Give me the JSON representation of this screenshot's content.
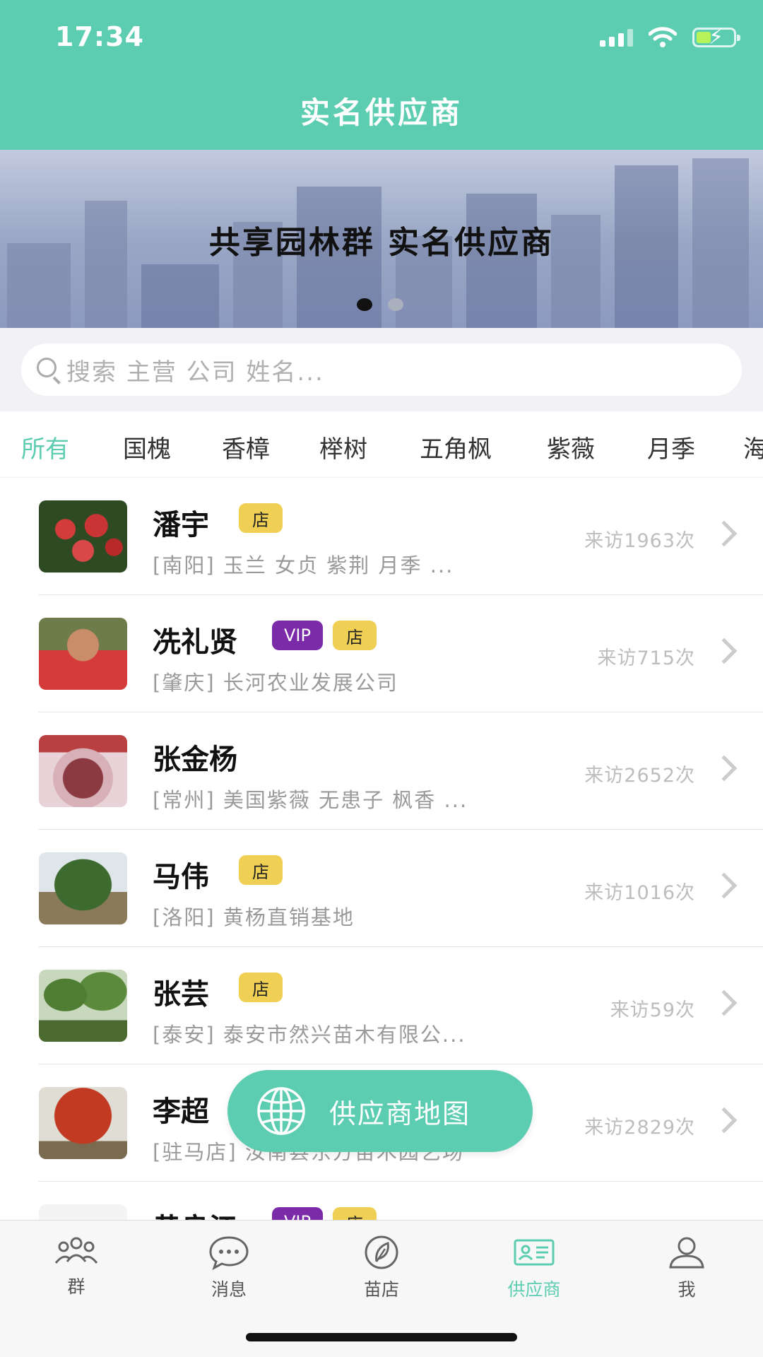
{
  "status_bar": {
    "time": "17:34"
  },
  "header": {
    "title": "实名供应商"
  },
  "banner": {
    "text": "共享园林群  实名供应商",
    "pages": 2,
    "active_page": 1
  },
  "search": {
    "placeholder": "搜索 主营 公司 姓名..."
  },
  "tabs": [
    "所有",
    "国槐",
    "香樟",
    "榉树",
    "五角枫",
    "紫薇",
    "月季",
    "海"
  ],
  "active_tab": "所有",
  "suppliers": [
    {
      "name": "潘宇",
      "vip": false,
      "shop": true,
      "desc": "[南阳] 玉兰 女贞 紫荆 月季 ...",
      "visits": "来访1963次",
      "avatar": "red-roses-photo"
    },
    {
      "name": "冼礼贤",
      "vip": true,
      "shop": true,
      "desc": "[肇庆] 长河农业发展公司",
      "visits": "来访715次",
      "avatar": "man-portrait-photo"
    },
    {
      "name": "张金杨",
      "vip": false,
      "shop": false,
      "desc": "[常州] 美国紫薇 无患子 枫香 ...",
      "visits": "来访2652次",
      "avatar": "logo-photo"
    },
    {
      "name": "马伟",
      "vip": false,
      "shop": true,
      "desc": "[洛阳] 黄杨直销基地",
      "visits": "来访1016次",
      "avatar": "tree-nursery-photo"
    },
    {
      "name": "张芸",
      "vip": false,
      "shop": true,
      "desc": "[泰安] 泰安市然兴苗木有限公...",
      "visits": "来访59次",
      "avatar": "green-trees-photo"
    },
    {
      "name": "李超",
      "vip": false,
      "shop": false,
      "desc": "[驻马店] 汝南县东方苗木园艺场",
      "visits": "来访2829次",
      "avatar": "red-maple-photo"
    },
    {
      "name": "黄良江",
      "vip": true,
      "shop": true,
      "desc": "",
      "visits": "",
      "avatar": "white-photo"
    }
  ],
  "labels": {
    "vip": "VIP",
    "shop": "店"
  },
  "map_button": {
    "label": "供应商地图"
  },
  "bottom_nav": [
    {
      "label": "群",
      "icon": "group-icon"
    },
    {
      "label": "消息",
      "icon": "message-icon"
    },
    {
      "label": "苗店",
      "icon": "leaf-icon"
    },
    {
      "label": "供应商",
      "icon": "supplier-card-icon",
      "active": true
    },
    {
      "label": "我",
      "icon": "person-icon"
    }
  ],
  "colors": {
    "accent": "#5ccdb0",
    "vip": "#7b2aa8",
    "shop": "#f0cf55"
  }
}
